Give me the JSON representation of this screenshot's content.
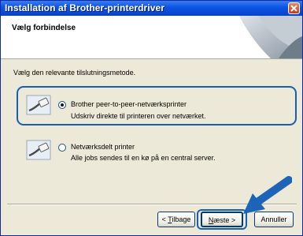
{
  "window": {
    "title": "Installation af Brother-printerdriver"
  },
  "header": {
    "title": "Vælg forbindelse"
  },
  "instruction": "Vælg den relevante tilslutningsmetode.",
  "options": [
    {
      "title": "Brother peer-to-peer-netværksprinter",
      "description": "Udskriv direkte til printeren over netværket.",
      "selected": true
    },
    {
      "title": "Netværksdelt printer",
      "description": "Alle jobs sendes til en kø på en central server.",
      "selected": false
    }
  ],
  "buttons": {
    "back_accel": "T",
    "back_rest": "ilbage",
    "back_prefix": "< ",
    "next_accel": "N",
    "next_rest": "æste >",
    "cancel": "Annuller"
  },
  "colors": {
    "highlight": "#1560b5",
    "titlebar": "#0a54e3",
    "dialog_bg": "#ece9d8"
  }
}
